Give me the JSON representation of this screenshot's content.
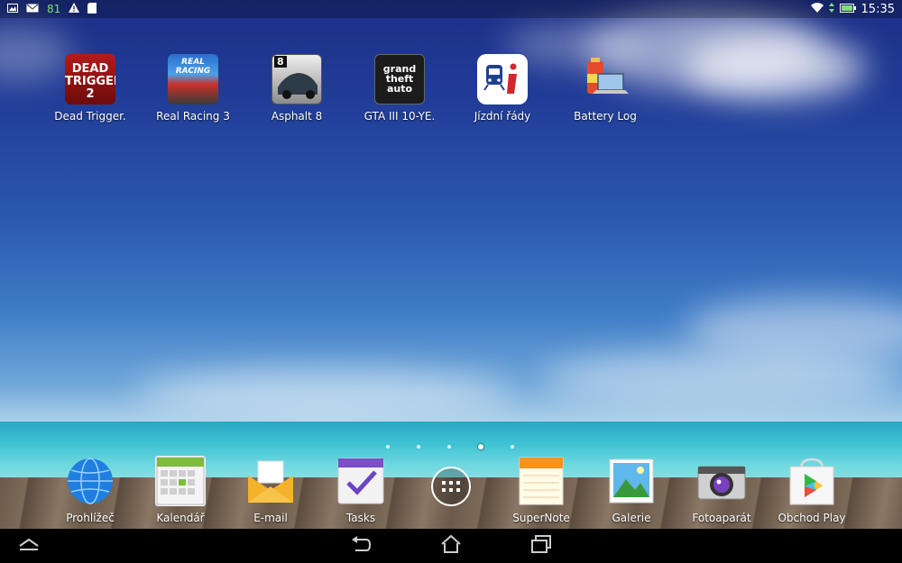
{
  "statusbar": {
    "battery_number": "81",
    "time": "15:35",
    "icons": [
      "image-notification-icon",
      "mail-icon",
      "warning-icon",
      "sd-card-icon",
      "wifi-icon",
      "battery-icon"
    ]
  },
  "home_apps": [
    {
      "label": "Dead Trigger.",
      "icon": "dead-trigger-2-icon"
    },
    {
      "label": "Real Racing 3",
      "icon": "real-racing-3-icon"
    },
    {
      "label": "Asphalt 8",
      "icon": "asphalt-8-icon"
    },
    {
      "label": "GTA III 10-YE.",
      "icon": "gta-3-icon"
    },
    {
      "label": "Jízdní řády",
      "icon": "train-timetable-icon"
    },
    {
      "label": "Battery Log",
      "icon": "battery-log-icon"
    }
  ],
  "dock_apps": [
    {
      "label": "Prohlížeč",
      "icon": "browser-globe-icon"
    },
    {
      "label": "Kalendář",
      "icon": "calendar-icon"
    },
    {
      "label": "E-mail",
      "icon": "email-envelope-icon"
    },
    {
      "label": "Tasks",
      "icon": "tasks-checkbox-icon"
    },
    {
      "label": "",
      "icon": "all-apps-icon"
    },
    {
      "label": "SuperNote",
      "icon": "supernote-icon"
    },
    {
      "label": "Galerie",
      "icon": "gallery-icon"
    },
    {
      "label": "Fotoaparát",
      "icon": "camera-icon"
    },
    {
      "label": "Obchod Play",
      "icon": "play-store-icon"
    }
  ],
  "app_icon_text": {
    "dead_trigger": "DEAD TRIGGER 2",
    "real_racing": "REAL RACING",
    "asphalt_num": "8",
    "gta": "grand theft auto"
  },
  "page_indicator": {
    "count": 5,
    "active_index": 3
  },
  "navbar": {
    "icons": [
      "menu-up-icon",
      "back-icon",
      "home-icon",
      "recent-apps-icon"
    ]
  },
  "colors": {
    "wallpaper_top": "#1c2f86",
    "sea": "#3dc2d3",
    "navbar": "#000000"
  }
}
